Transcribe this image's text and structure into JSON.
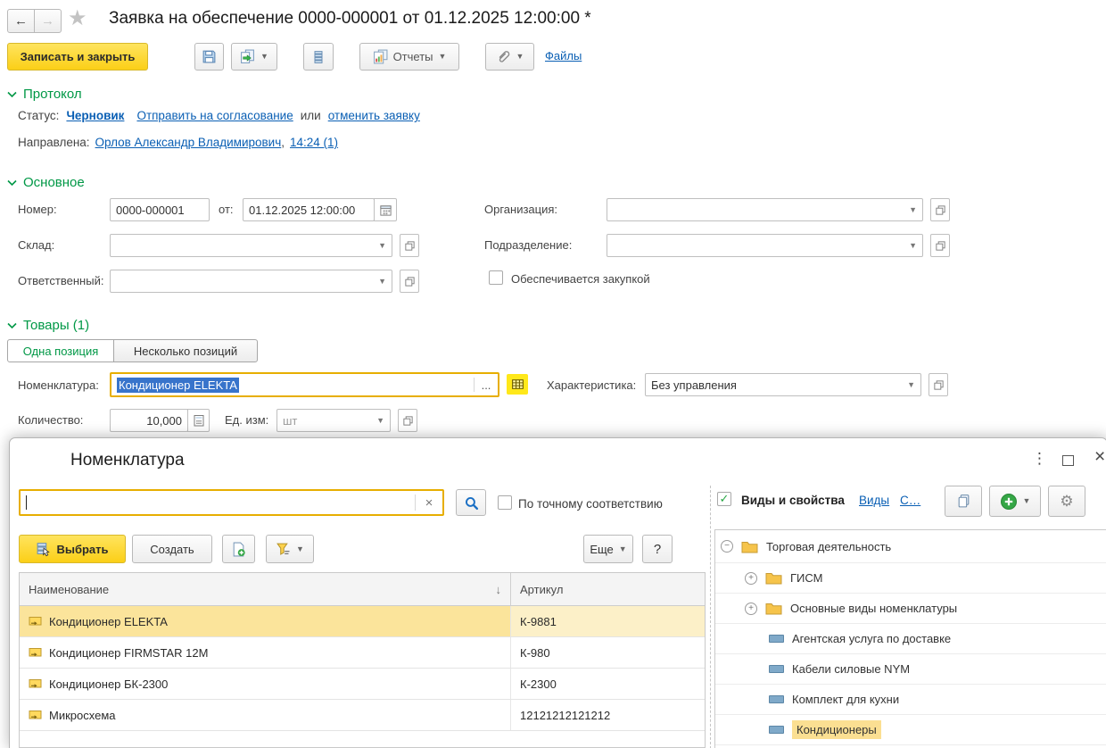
{
  "colors": {
    "section_green": "#009846",
    "link_blue": "#0a5fb4",
    "focus_border": "#e7ae00",
    "selection_blue": "#3874cb",
    "accent_yellow": "#ffd422",
    "row_highlight": "#fbe49b"
  },
  "glyphs": {
    "back": "←",
    "forward": "→",
    "star": "★",
    "check": "✓",
    "menu_dots": "⋮",
    "close": "×",
    "clear": "×",
    "sort_desc": "↓",
    "gear": "⚙",
    "plus": "+",
    "minus": "−"
  },
  "header": {
    "title": "Заявка на обеспечение 0000-000001 от 01.12.2025 12:00:00 *"
  },
  "toolbar": {
    "save_close": "Записать и закрыть",
    "reports": "Отчеты",
    "files": "Файлы"
  },
  "protocol": {
    "section": "Протокол",
    "status_label": "Статус:",
    "status_value": "Черновик",
    "send_link": "Отправить на согласование",
    "or_text": "или",
    "cancel_link": "отменить заявку",
    "sent_label": "Направлена:",
    "sent_person": "Орлов Александр Владимирович",
    "sent_sep": ",",
    "sent_time": "14:24 (1)"
  },
  "main": {
    "section": "Основное",
    "number_label": "Номер:",
    "number_value": "0000-000001",
    "date_prefix": "от:",
    "date_value": "01.12.2025 12:00:00",
    "org_label": "Организация:",
    "warehouse_label": "Склад:",
    "division_label": "Подразделение:",
    "responsible_label": "Ответственный:",
    "purchase_label": "Обеспечивается закупкой",
    "purchase_checked": false
  },
  "goods": {
    "section": "Товары (1)",
    "tab_single": "Одна позиция",
    "tab_multi": "Несколько позиций",
    "nomenclature_label": "Номенклатура:",
    "nomenclature_value": "Кондиционер ELEKTA",
    "ellipsis": "...",
    "characteristic_label": "Характеристика:",
    "characteristic_value": "Без управления",
    "qty_label": "Количество:",
    "qty_value": "10,000",
    "unit_label": "Ед. изм:",
    "unit_placeholder": "шт"
  },
  "dialog": {
    "title": "Номенклатура",
    "exact_label": "По точному соответствию",
    "exact_checked": false,
    "select_btn": "Выбрать",
    "create_btn": "Создать",
    "more_btn": "Еще",
    "help_btn": "?",
    "types_title": "Виды и свойства",
    "types_checked": true,
    "types_link": "Виды",
    "props_link": "С…",
    "table": {
      "columns": [
        "Наименование",
        "Артикул"
      ],
      "rows": [
        {
          "name": "Кондиционер ELEKTA",
          "sku": "К-9881",
          "selected": true
        },
        {
          "name": "Кондиционер FIRMSTAR 12M",
          "sku": "К-980",
          "selected": false
        },
        {
          "name": "Кондиционер БК-2300",
          "sku": "К-2300",
          "selected": false
        },
        {
          "name": "Микросхема",
          "sku": "12121212121212",
          "selected": false
        }
      ]
    },
    "tree": [
      {
        "label": "Торговая деятельность",
        "level": 0,
        "type": "folder",
        "expander": "minus",
        "highlighted": false
      },
      {
        "label": "ГИСМ",
        "level": 1,
        "type": "folder",
        "expander": "plus",
        "highlighted": false
      },
      {
        "label": "Основные виды номенклатуры",
        "level": 1,
        "type": "folder",
        "expander": "plus",
        "highlighted": false
      },
      {
        "label": "Агентская услуга по доставке",
        "level": 2,
        "type": "item",
        "expander": "",
        "highlighted": false
      },
      {
        "label": "Кабели силовые NYM",
        "level": 2,
        "type": "item",
        "expander": "",
        "highlighted": false
      },
      {
        "label": "Комплект для кухни",
        "level": 2,
        "type": "item",
        "expander": "",
        "highlighted": false
      },
      {
        "label": "Кондиционеры",
        "level": 2,
        "type": "item",
        "expander": "",
        "highlighted": true
      }
    ]
  }
}
